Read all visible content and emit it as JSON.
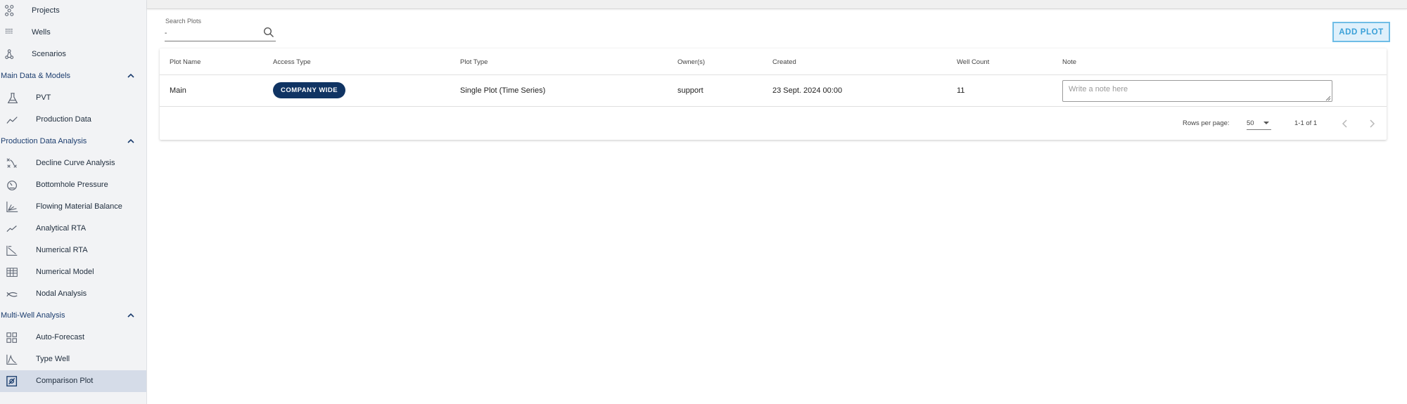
{
  "sidebar": {
    "top_items": [
      {
        "label": "Projects",
        "icon": "projects-icon"
      },
      {
        "label": "Wells",
        "icon": "wells-icon"
      },
      {
        "label": "Scenarios",
        "icon": "scenarios-icon"
      }
    ],
    "sections": [
      {
        "title": "Main Data & Models",
        "items": [
          {
            "label": "PVT",
            "icon": "flask-icon"
          },
          {
            "label": "Production Data",
            "icon": "trend-icon"
          }
        ]
      },
      {
        "title": "Production Data Analysis",
        "items": [
          {
            "label": "Decline Curve Analysis",
            "icon": "decline-icon"
          },
          {
            "label": "Bottomhole Pressure",
            "icon": "gauge-icon"
          },
          {
            "label": "Flowing Material Balance",
            "icon": "chart-lines-icon"
          },
          {
            "label": "Analytical RTA",
            "icon": "analytical-icon"
          },
          {
            "label": "Numerical RTA",
            "icon": "numerical-rta-icon"
          },
          {
            "label": "Numerical Model",
            "icon": "grid-model-icon"
          },
          {
            "label": "Nodal Analysis",
            "icon": "nodal-icon"
          }
        ]
      },
      {
        "title": "Multi-Well Analysis",
        "items": [
          {
            "label": "Auto-Forecast",
            "icon": "dashboard-icon"
          },
          {
            "label": "Type Well",
            "icon": "type-well-icon"
          },
          {
            "label": "Comparison Plot",
            "icon": "comparison-icon",
            "active": true
          }
        ]
      }
    ]
  },
  "search": {
    "label": "Search Plots",
    "value": "-"
  },
  "add_button_label": "ADD PLOT",
  "table": {
    "headers": [
      "Plot Name",
      "Access Type",
      "Plot Type",
      "Owner(s)",
      "Created",
      "Well Count",
      "Note"
    ],
    "rows": [
      {
        "name": "Main",
        "access": "COMPANY WIDE",
        "plot_type": "Single Plot (Time Series)",
        "owner": "support",
        "created": "23 Sept. 2024 00:00",
        "well_count": "11",
        "note_placeholder": "Write a note here"
      }
    ]
  },
  "pagination": {
    "rows_per_page_label": "Rows per page:",
    "rows_per_page": "50",
    "range": "1-1 of 1"
  },
  "colors": {
    "primary": "#103463",
    "accent": "#3aa0d8",
    "active_bg": "#d5dce8"
  }
}
